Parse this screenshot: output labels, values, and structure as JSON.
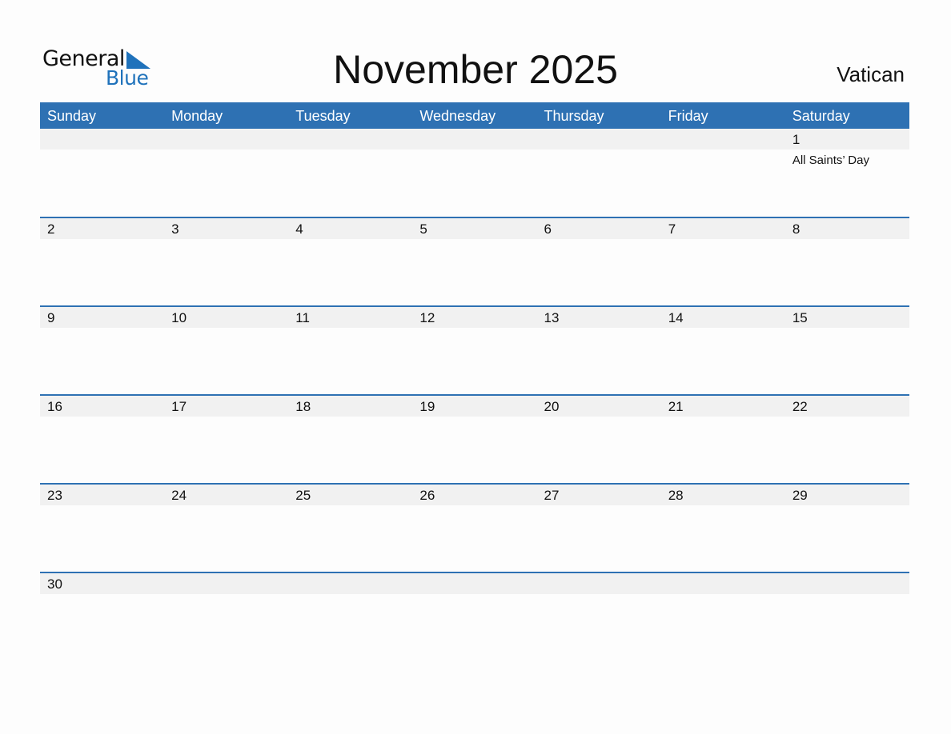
{
  "logo": {
    "line1": "General",
    "line2": "Blue",
    "icon": "triangle-flag-icon"
  },
  "title": "November 2025",
  "country": "Vatican",
  "colors": {
    "accent": "#2e71b3",
    "strip": "#f1f1f1",
    "logo_blue": "#1f72bb"
  },
  "weekdays": [
    "Sunday",
    "Monday",
    "Tuesday",
    "Wednesday",
    "Thursday",
    "Friday",
    "Saturday"
  ],
  "weeks": [
    {
      "days": [
        {
          "day": "",
          "event": ""
        },
        {
          "day": "",
          "event": ""
        },
        {
          "day": "",
          "event": ""
        },
        {
          "day": "",
          "event": ""
        },
        {
          "day": "",
          "event": ""
        },
        {
          "day": "",
          "event": ""
        },
        {
          "day": "1",
          "event": "All Saints’ Day"
        }
      ]
    },
    {
      "days": [
        {
          "day": "2",
          "event": ""
        },
        {
          "day": "3",
          "event": ""
        },
        {
          "day": "4",
          "event": ""
        },
        {
          "day": "5",
          "event": ""
        },
        {
          "day": "6",
          "event": ""
        },
        {
          "day": "7",
          "event": ""
        },
        {
          "day": "8",
          "event": ""
        }
      ]
    },
    {
      "days": [
        {
          "day": "9",
          "event": ""
        },
        {
          "day": "10",
          "event": ""
        },
        {
          "day": "11",
          "event": ""
        },
        {
          "day": "12",
          "event": ""
        },
        {
          "day": "13",
          "event": ""
        },
        {
          "day": "14",
          "event": ""
        },
        {
          "day": "15",
          "event": ""
        }
      ]
    },
    {
      "days": [
        {
          "day": "16",
          "event": ""
        },
        {
          "day": "17",
          "event": ""
        },
        {
          "day": "18",
          "event": ""
        },
        {
          "day": "19",
          "event": ""
        },
        {
          "day": "20",
          "event": ""
        },
        {
          "day": "21",
          "event": ""
        },
        {
          "day": "22",
          "event": ""
        }
      ]
    },
    {
      "days": [
        {
          "day": "23",
          "event": ""
        },
        {
          "day": "24",
          "event": ""
        },
        {
          "day": "25",
          "event": ""
        },
        {
          "day": "26",
          "event": ""
        },
        {
          "day": "27",
          "event": ""
        },
        {
          "day": "28",
          "event": ""
        },
        {
          "day": "29",
          "event": ""
        }
      ]
    },
    {
      "days": [
        {
          "day": "30",
          "event": ""
        },
        {
          "day": "",
          "event": ""
        },
        {
          "day": "",
          "event": ""
        },
        {
          "day": "",
          "event": ""
        },
        {
          "day": "",
          "event": ""
        },
        {
          "day": "",
          "event": ""
        },
        {
          "day": "",
          "event": ""
        }
      ]
    }
  ]
}
